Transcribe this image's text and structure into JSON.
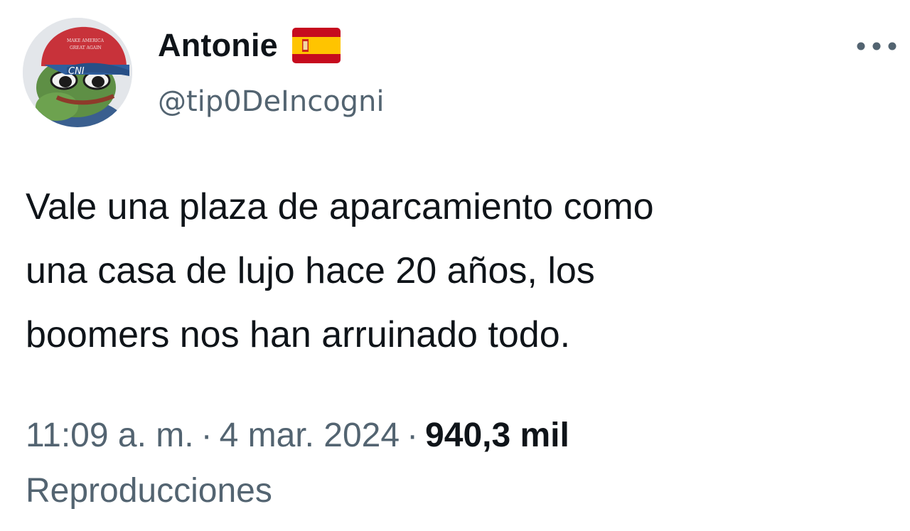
{
  "author": {
    "name": "Antonie",
    "flag_emoji": "spain-flag-icon",
    "handle": "@tip0DeIncogni",
    "avatar_cap_text": "CNI"
  },
  "tweet": {
    "text": "Vale una plaza de aparcamiento como\nuna casa de lujo hace 20 años, los\nboomers nos han arruinado todo."
  },
  "meta": {
    "time": "11:09 a. m.",
    "date": "4 mar. 2024",
    "separator": "·",
    "views_count": "940,3 mil",
    "views_label": "Reproducciones"
  },
  "icons": {
    "more": "more-horizontal-icon"
  },
  "colors": {
    "text_primary": "#0f1419",
    "text_secondary": "#536471",
    "background": "#ffffff",
    "flag_red": "#c60b1e",
    "flag_yellow": "#ffc400"
  }
}
